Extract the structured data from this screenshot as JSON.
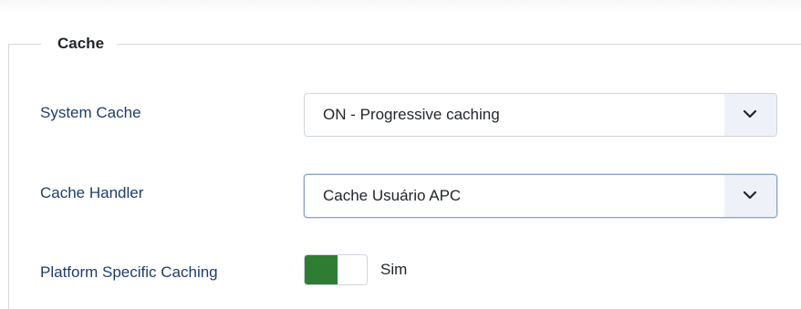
{
  "fieldset": {
    "legend": "Cache"
  },
  "fields": [
    {
      "label": "System Cache",
      "value": "ON - Progressive caching"
    },
    {
      "label": "Cache Handler",
      "value": "Cache Usuário APC"
    },
    {
      "label": "Platform Specific Caching",
      "toggle_state": "on",
      "toggle_text": "Sim"
    }
  ],
  "colors": {
    "label": "#1f3c6e",
    "toggle_on": "#2e7d32",
    "chevron_bg": "#eef2f8"
  },
  "icons": {
    "select_indicator": "chevron-down-icon"
  }
}
